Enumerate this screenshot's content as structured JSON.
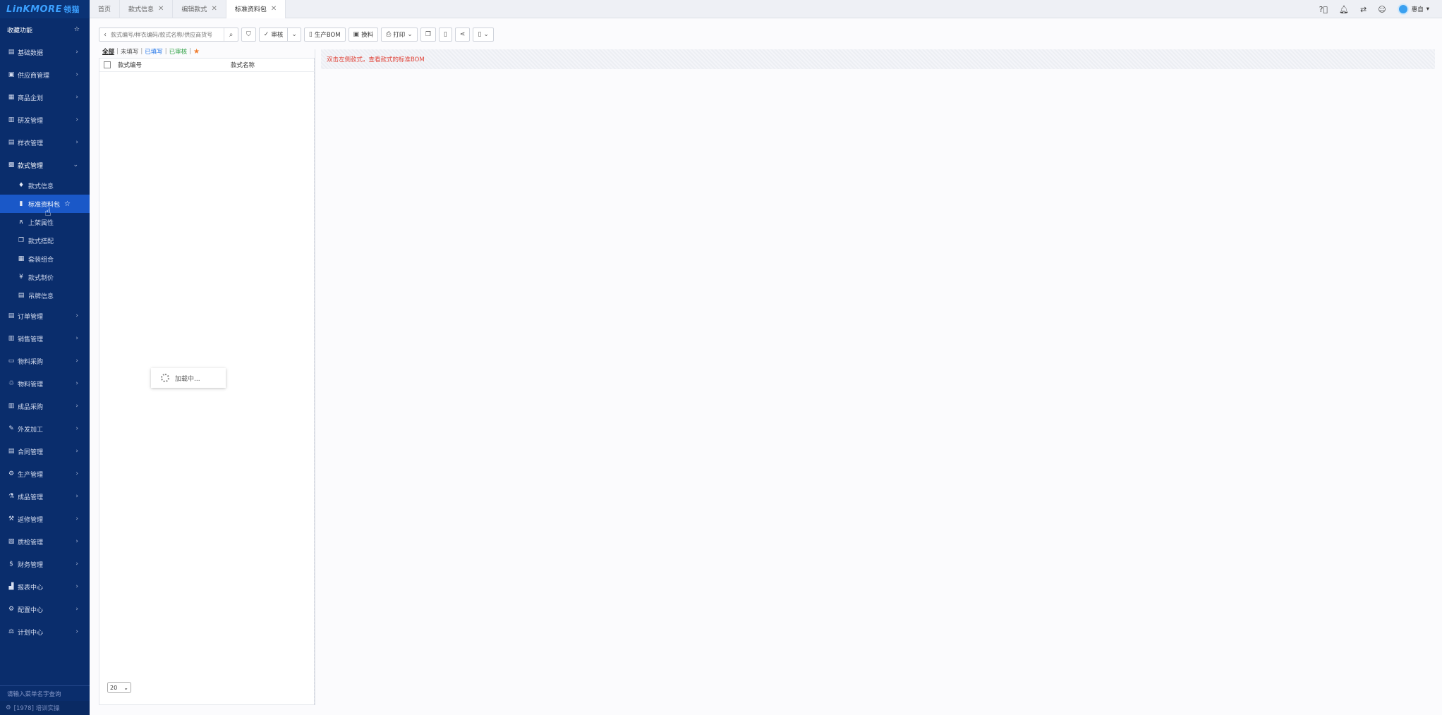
{
  "app": {
    "logo_text": "LinKMORE",
    "logo_cn": "领猫"
  },
  "sidebar": {
    "favorites_label": "收藏功能",
    "items": [
      {
        "label": "基础数据",
        "icon": "database-icon",
        "glyph": "▤"
      },
      {
        "label": "供应商管理",
        "icon": "supplier-icon",
        "glyph": "▣"
      },
      {
        "label": "商品企划",
        "icon": "calendar-icon",
        "glyph": "▦"
      },
      {
        "label": "研发管理",
        "icon": "research-icon",
        "glyph": "▥"
      },
      {
        "label": "样衣管理",
        "icon": "sample-icon",
        "glyph": "▤"
      },
      {
        "label": "款式管理",
        "icon": "style-icon",
        "glyph": "▩"
      }
    ],
    "sub_items": [
      {
        "label": "款式信息",
        "icon": "shirt-icon",
        "glyph": "♦"
      },
      {
        "label": "标准资料包",
        "icon": "book-icon",
        "glyph": "▮"
      },
      {
        "label": "上架属性",
        "icon": "binoculars-icon",
        "glyph": "ጸ"
      },
      {
        "label": "款式搭配",
        "icon": "copy-icon",
        "glyph": "❐"
      },
      {
        "label": "套装组合",
        "icon": "calculator-icon",
        "glyph": "▦"
      },
      {
        "label": "款式制价",
        "icon": "yen-icon",
        "glyph": "¥"
      },
      {
        "label": "吊牌信息",
        "icon": "tag-doc-icon",
        "glyph": "▤"
      }
    ],
    "items_after": [
      {
        "label": "订单管理",
        "icon": "order-icon",
        "glyph": "▤"
      },
      {
        "label": "销售管理",
        "icon": "bank-icon",
        "glyph": "▥"
      },
      {
        "label": "物料采购",
        "icon": "purchase-icon",
        "glyph": "▭"
      },
      {
        "label": "物料管理",
        "icon": "material-icon",
        "glyph": "♲"
      },
      {
        "label": "成品采购",
        "icon": "product-purchase-icon",
        "glyph": "▥"
      },
      {
        "label": "外发加工",
        "icon": "outsource-icon",
        "glyph": "✎"
      },
      {
        "label": "合同管理",
        "icon": "contract-icon",
        "glyph": "▤"
      },
      {
        "label": "生产管理",
        "icon": "production-icon",
        "glyph": "⚙"
      },
      {
        "label": "成品管理",
        "icon": "flask-icon",
        "glyph": "⚗"
      },
      {
        "label": "返修管理",
        "icon": "repair-icon",
        "glyph": "⚒"
      },
      {
        "label": "质检管理",
        "icon": "inspection-icon",
        "glyph": "▧"
      },
      {
        "label": "财务管理",
        "icon": "dollar-icon",
        "glyph": "$"
      },
      {
        "label": "报表中心",
        "icon": "report-icon",
        "glyph": "▟"
      },
      {
        "label": "配置中心",
        "icon": "config-icon",
        "glyph": "⚙"
      },
      {
        "label": "计划中心",
        "icon": "plan-icon",
        "glyph": "⚖"
      }
    ],
    "search_placeholder": "请输入菜单名字查询",
    "footer": "[1978] 培训实操"
  },
  "tabs": [
    {
      "label": "首页",
      "closable": false,
      "active": false
    },
    {
      "label": "款式信息",
      "closable": true,
      "active": false
    },
    {
      "label": "编辑款式",
      "closable": true,
      "active": false
    },
    {
      "label": "标准资料包",
      "closable": true,
      "active": true
    }
  ],
  "header_right": {
    "user_name": "惠自"
  },
  "toolbar": {
    "search_placeholder": "款式编号/样衣编码/款式名称/供应商货号",
    "audit_label": "审核",
    "bom_label": "生产BOM",
    "swap_label": "换料",
    "print_label": "打印"
  },
  "filters": {
    "all": "全部",
    "unfilled": "未填写",
    "filled": "已填写",
    "audited": "已审核"
  },
  "list": {
    "col_code": "款式编号",
    "col_name": "款式名称",
    "loading_text": "加载中...",
    "page_size": "20"
  },
  "right": {
    "hint": "双击左侧款式，查看款式的标准BOM"
  },
  "colors": {
    "sidebar_bg": "#0a2d6c",
    "active_item": "#1a58c8",
    "hint_red": "#e0453a",
    "filled_blue": "#1e73e8",
    "audited_green": "#2ea043",
    "star_orange": "#f07b2c"
  }
}
